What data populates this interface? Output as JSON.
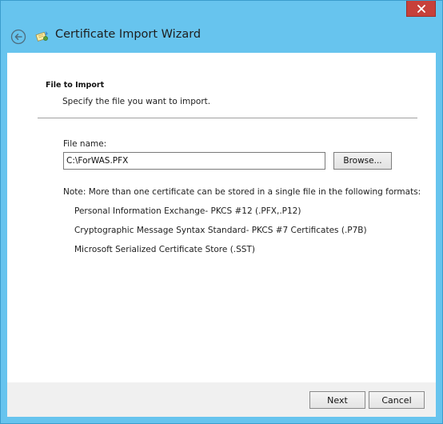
{
  "window": {
    "title": "Certificate Import Wizard",
    "close_icon": "close-icon",
    "back_icon": "back-arrow-icon",
    "wizard_icon": "certificate-icon",
    "accent_color": "#67c4ee",
    "close_color": "#c7403a"
  },
  "section": {
    "heading": "File to Import",
    "description": "Specify the file you want to import."
  },
  "file": {
    "label": "File name:",
    "value": "C:\\ForWAS.PFX",
    "browse_label": "Browse..."
  },
  "note": {
    "text": "Note:  More than one certificate can be stored in a single file in the following formats:",
    "formats": [
      "Personal Information Exchange- PKCS #12 (.PFX,.P12)",
      "Cryptographic Message Syntax Standard- PKCS #7 Certificates (.P7B)",
      "Microsoft Serialized Certificate Store (.SST)"
    ]
  },
  "footer": {
    "next_label": "Next",
    "cancel_label": "Cancel"
  }
}
